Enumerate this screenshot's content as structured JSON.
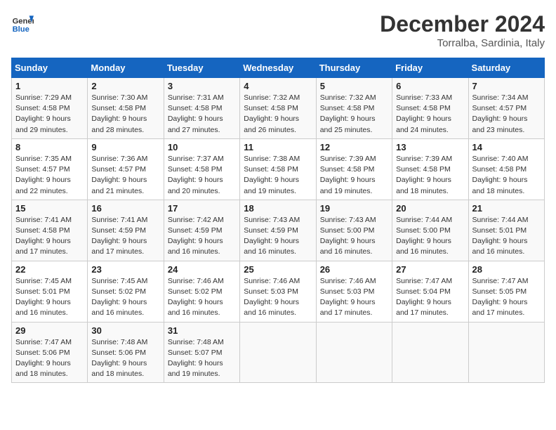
{
  "header": {
    "logo_line1": "General",
    "logo_line2": "Blue",
    "month_year": "December 2024",
    "location": "Torralba, Sardinia, Italy"
  },
  "days_of_week": [
    "Sunday",
    "Monday",
    "Tuesday",
    "Wednesday",
    "Thursday",
    "Friday",
    "Saturday"
  ],
  "weeks": [
    [
      {
        "day": "1",
        "sunrise": "7:29 AM",
        "sunset": "4:58 PM",
        "daylight": "9 hours and 29 minutes."
      },
      {
        "day": "2",
        "sunrise": "7:30 AM",
        "sunset": "4:58 PM",
        "daylight": "9 hours and 28 minutes."
      },
      {
        "day": "3",
        "sunrise": "7:31 AM",
        "sunset": "4:58 PM",
        "daylight": "9 hours and 27 minutes."
      },
      {
        "day": "4",
        "sunrise": "7:32 AM",
        "sunset": "4:58 PM",
        "daylight": "9 hours and 26 minutes."
      },
      {
        "day": "5",
        "sunrise": "7:32 AM",
        "sunset": "4:58 PM",
        "daylight": "9 hours and 25 minutes."
      },
      {
        "day": "6",
        "sunrise": "7:33 AM",
        "sunset": "4:58 PM",
        "daylight": "9 hours and 24 minutes."
      },
      {
        "day": "7",
        "sunrise": "7:34 AM",
        "sunset": "4:57 PM",
        "daylight": "9 hours and 23 minutes."
      }
    ],
    [
      {
        "day": "8",
        "sunrise": "7:35 AM",
        "sunset": "4:57 PM",
        "daylight": "9 hours and 22 minutes."
      },
      {
        "day": "9",
        "sunrise": "7:36 AM",
        "sunset": "4:57 PM",
        "daylight": "9 hours and 21 minutes."
      },
      {
        "day": "10",
        "sunrise": "7:37 AM",
        "sunset": "4:58 PM",
        "daylight": "9 hours and 20 minutes."
      },
      {
        "day": "11",
        "sunrise": "7:38 AM",
        "sunset": "4:58 PM",
        "daylight": "9 hours and 19 minutes."
      },
      {
        "day": "12",
        "sunrise": "7:39 AM",
        "sunset": "4:58 PM",
        "daylight": "9 hours and 19 minutes."
      },
      {
        "day": "13",
        "sunrise": "7:39 AM",
        "sunset": "4:58 PM",
        "daylight": "9 hours and 18 minutes."
      },
      {
        "day": "14",
        "sunrise": "7:40 AM",
        "sunset": "4:58 PM",
        "daylight": "9 hours and 18 minutes."
      }
    ],
    [
      {
        "day": "15",
        "sunrise": "7:41 AM",
        "sunset": "4:58 PM",
        "daylight": "9 hours and 17 minutes."
      },
      {
        "day": "16",
        "sunrise": "7:41 AM",
        "sunset": "4:59 PM",
        "daylight": "9 hours and 17 minutes."
      },
      {
        "day": "17",
        "sunrise": "7:42 AM",
        "sunset": "4:59 PM",
        "daylight": "9 hours and 16 minutes."
      },
      {
        "day": "18",
        "sunrise": "7:43 AM",
        "sunset": "4:59 PM",
        "daylight": "9 hours and 16 minutes."
      },
      {
        "day": "19",
        "sunrise": "7:43 AM",
        "sunset": "5:00 PM",
        "daylight": "9 hours and 16 minutes."
      },
      {
        "day": "20",
        "sunrise": "7:44 AM",
        "sunset": "5:00 PM",
        "daylight": "9 hours and 16 minutes."
      },
      {
        "day": "21",
        "sunrise": "7:44 AM",
        "sunset": "5:01 PM",
        "daylight": "9 hours and 16 minutes."
      }
    ],
    [
      {
        "day": "22",
        "sunrise": "7:45 AM",
        "sunset": "5:01 PM",
        "daylight": "9 hours and 16 minutes."
      },
      {
        "day": "23",
        "sunrise": "7:45 AM",
        "sunset": "5:02 PM",
        "daylight": "9 hours and 16 minutes."
      },
      {
        "day": "24",
        "sunrise": "7:46 AM",
        "sunset": "5:02 PM",
        "daylight": "9 hours and 16 minutes."
      },
      {
        "day": "25",
        "sunrise": "7:46 AM",
        "sunset": "5:03 PM",
        "daylight": "9 hours and 16 minutes."
      },
      {
        "day": "26",
        "sunrise": "7:46 AM",
        "sunset": "5:03 PM",
        "daylight": "9 hours and 17 minutes."
      },
      {
        "day": "27",
        "sunrise": "7:47 AM",
        "sunset": "5:04 PM",
        "daylight": "9 hours and 17 minutes."
      },
      {
        "day": "28",
        "sunrise": "7:47 AM",
        "sunset": "5:05 PM",
        "daylight": "9 hours and 17 minutes."
      }
    ],
    [
      {
        "day": "29",
        "sunrise": "7:47 AM",
        "sunset": "5:06 PM",
        "daylight": "9 hours and 18 minutes."
      },
      {
        "day": "30",
        "sunrise": "7:48 AM",
        "sunset": "5:06 PM",
        "daylight": "9 hours and 18 minutes."
      },
      {
        "day": "31",
        "sunrise": "7:48 AM",
        "sunset": "5:07 PM",
        "daylight": "9 hours and 19 minutes."
      },
      null,
      null,
      null,
      null
    ]
  ],
  "labels": {
    "sunrise": "Sunrise:",
    "sunset": "Sunset:",
    "daylight": "Daylight:"
  }
}
